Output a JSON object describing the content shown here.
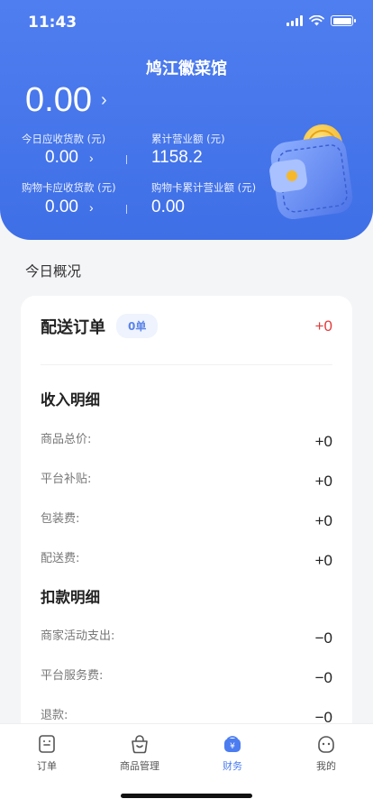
{
  "status_bar": {
    "time": "11:43"
  },
  "header": {
    "store_name": "鸠江徽菜馆",
    "balance": "0.00",
    "today_receivable_label": "今日应收货款 (元)",
    "today_receivable_value": "0.00",
    "total_revenue_label": "累计营业额 (元)",
    "total_revenue_value": "1158.2",
    "card_receivable_label": "购物卡应收货款 (元)",
    "card_receivable_value": "0.00",
    "card_total_revenue_label": "购物卡累计营业额 (元)",
    "card_total_revenue_value": "0.00"
  },
  "overview": {
    "section_title": "今日概况",
    "delivery_title": "配送订单",
    "delivery_badge": "0单",
    "delivery_value": "+0",
    "income": {
      "title": "收入明细",
      "items": [
        {
          "label": "商品总价:",
          "value": "+0"
        },
        {
          "label": "平台补贴:",
          "value": "+0"
        },
        {
          "label": "包装费:",
          "value": "+0"
        },
        {
          "label": "配送费:",
          "value": "+0"
        }
      ]
    },
    "deduction": {
      "title": "扣款明细",
      "items": [
        {
          "label": "商家活动支出:",
          "value": "−0"
        },
        {
          "label": "平台服务费:",
          "value": "−0"
        },
        {
          "label": "退款:",
          "value": "−0"
        }
      ]
    }
  },
  "tabbar": {
    "tabs": [
      {
        "label": "订单",
        "icon": "order-icon"
      },
      {
        "label": "商品管理",
        "icon": "bag-icon"
      },
      {
        "label": "财务",
        "icon": "finance-icon"
      },
      {
        "label": "我的",
        "icon": "profile-icon"
      }
    ],
    "active_index": 2
  },
  "colors": {
    "primary": "#4b7cf0",
    "accent_red": "#e53a3a"
  }
}
